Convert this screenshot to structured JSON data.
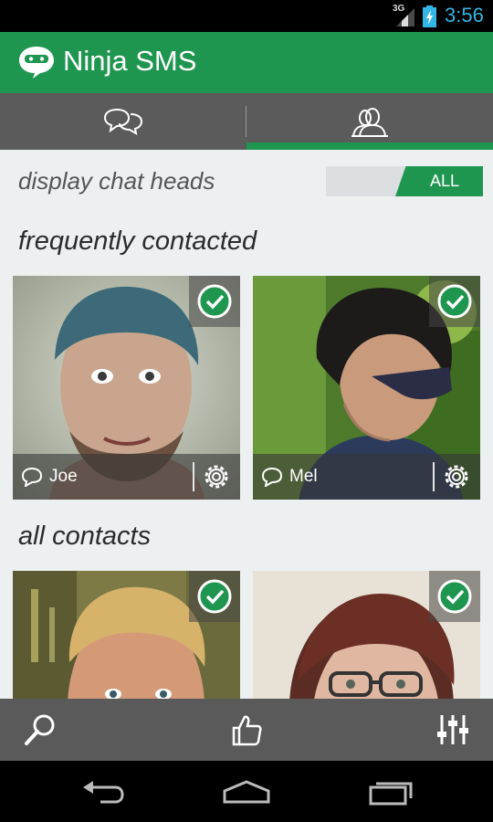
{
  "status_bar": {
    "network": "3G",
    "time": "3:56",
    "clock_color": "#33b5e5"
  },
  "app_bar": {
    "title": "Ninja SMS",
    "color": "#1f9650",
    "logo_icon": "ninja-chat-icon"
  },
  "tabs": [
    {
      "icon": "chat-bubbles-icon",
      "selected": false
    },
    {
      "icon": "contacts-icon",
      "selected": true
    }
  ],
  "chat_heads": {
    "label": "display chat heads",
    "toggle_value": "ALL"
  },
  "sections": {
    "frequent": "frequently contacted",
    "all": "all contacts"
  },
  "frequent_contacts": [
    {
      "name": "Joe",
      "checked": true
    },
    {
      "name": "Mel",
      "checked": true
    }
  ],
  "all_contacts": [
    {
      "name": "",
      "checked": true
    },
    {
      "name": "",
      "checked": true
    }
  ],
  "bottom_bar": {
    "actions": [
      "search-icon",
      "thumbs-up-icon",
      "equalizer-icon"
    ]
  },
  "nav_bar": {
    "buttons": [
      "back-icon",
      "home-icon",
      "recent-apps-icon"
    ]
  }
}
